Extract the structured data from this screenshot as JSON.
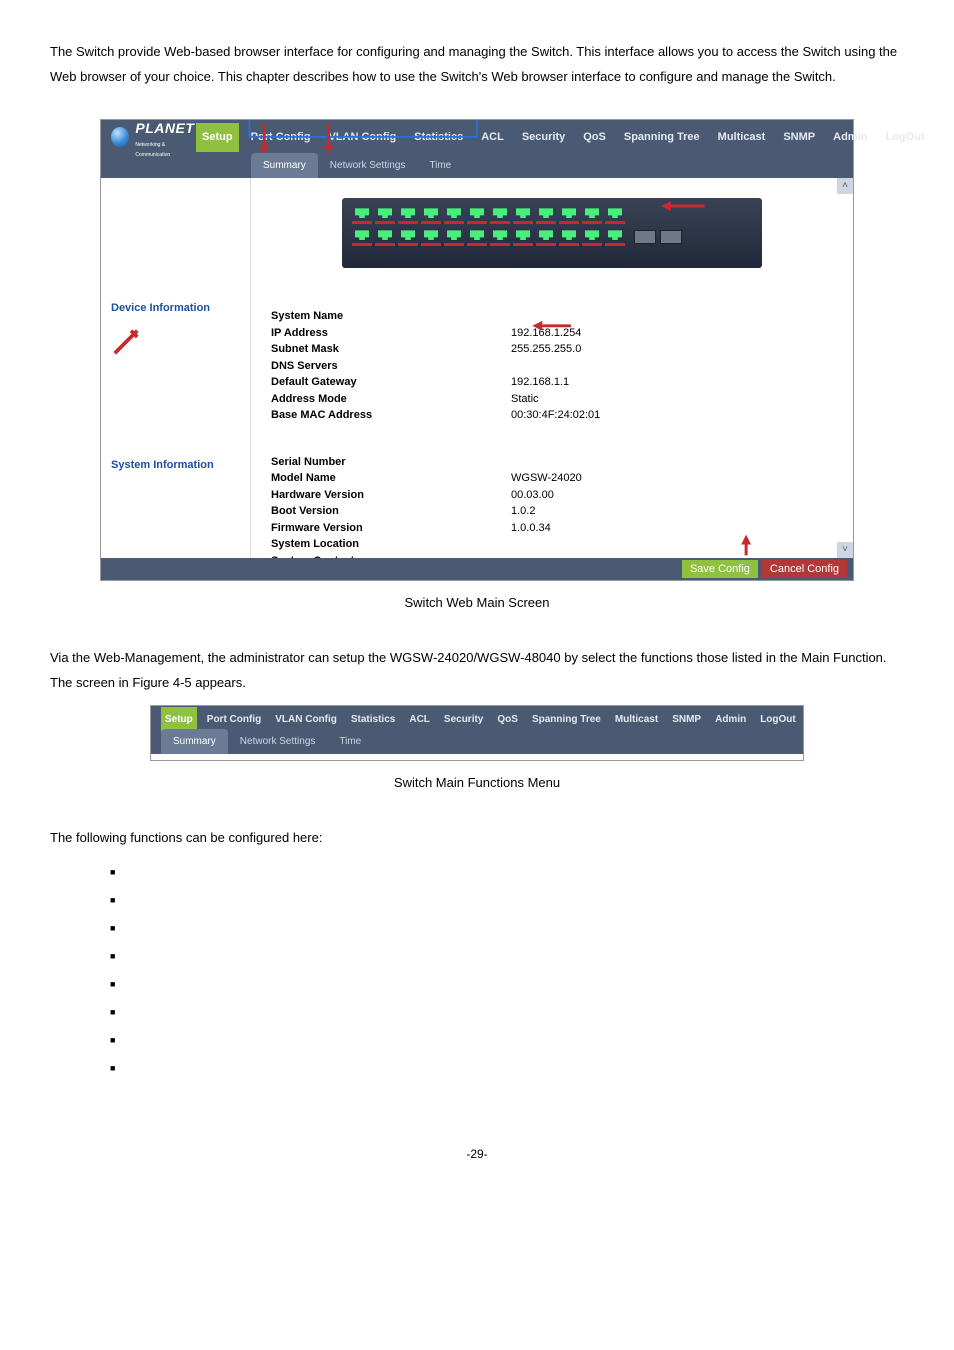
{
  "intro": "The Switch provide Web-based browser interface for configuring and managing the Switch. This interface allows you to access the Switch using the Web browser of your choice. This chapter describes how to use the Switch's Web browser interface to configure and manage the Switch.",
  "logo": {
    "brand": "PLANET",
    "sub": "Networking & Communication"
  },
  "nav": {
    "items": [
      "Setup",
      "Port Config",
      "VLAN Config",
      "Statistics",
      "ACL",
      "Security",
      "QoS",
      "Spanning Tree",
      "Multicast",
      "SNMP",
      "Admin",
      "LogOut"
    ],
    "active": "Setup"
  },
  "subnav": {
    "items": [
      "Summary",
      "Network Settings",
      "Time"
    ],
    "active": "Summary"
  },
  "left": {
    "section1": "Device Information",
    "section2": "System Information"
  },
  "device_info": {
    "rows": [
      {
        "label": "System Name",
        "value": ""
      },
      {
        "label": "IP Address",
        "value": "192.168.1.254"
      },
      {
        "label": "Subnet Mask",
        "value": "255.255.255.0"
      },
      {
        "label": "DNS Servers",
        "value": ""
      },
      {
        "label": "Default Gateway",
        "value": "192.168.1.1"
      },
      {
        "label": "Address Mode",
        "value": "Static"
      },
      {
        "label": "Base MAC Address",
        "value": "00:30:4F:24:02:01"
      }
    ]
  },
  "system_info": {
    "rows": [
      {
        "label": "Serial Number",
        "value": ""
      },
      {
        "label": "Model Name",
        "value": "WGSW-24020"
      },
      {
        "label": "Hardware Version",
        "value": "00.03.00"
      },
      {
        "label": "Boot Version",
        "value": "1.0.2"
      },
      {
        "label": "Firmware Version",
        "value": "1.0.0.34"
      },
      {
        "label": "",
        "value": ""
      },
      {
        "label": "System Location",
        "value": ""
      },
      {
        "label": "System Contact",
        "value": ""
      }
    ]
  },
  "buttons": {
    "save": "Save Config",
    "cancel": "Cancel Config"
  },
  "caption1": "Switch Web Main Screen",
  "para2": "Via the Web-Management, the administrator can setup the WGSW-24020/WGSW-48040 by select the functions those listed in the Main Function. The screen in Figure 4-5 appears.",
  "caption2": "Switch Main Functions Menu",
  "followline": "The following functions can be configured here:",
  "funclist": [
    "",
    "",
    "",
    "",
    "",
    "",
    "",
    ""
  ],
  "pagenum": "-29-"
}
